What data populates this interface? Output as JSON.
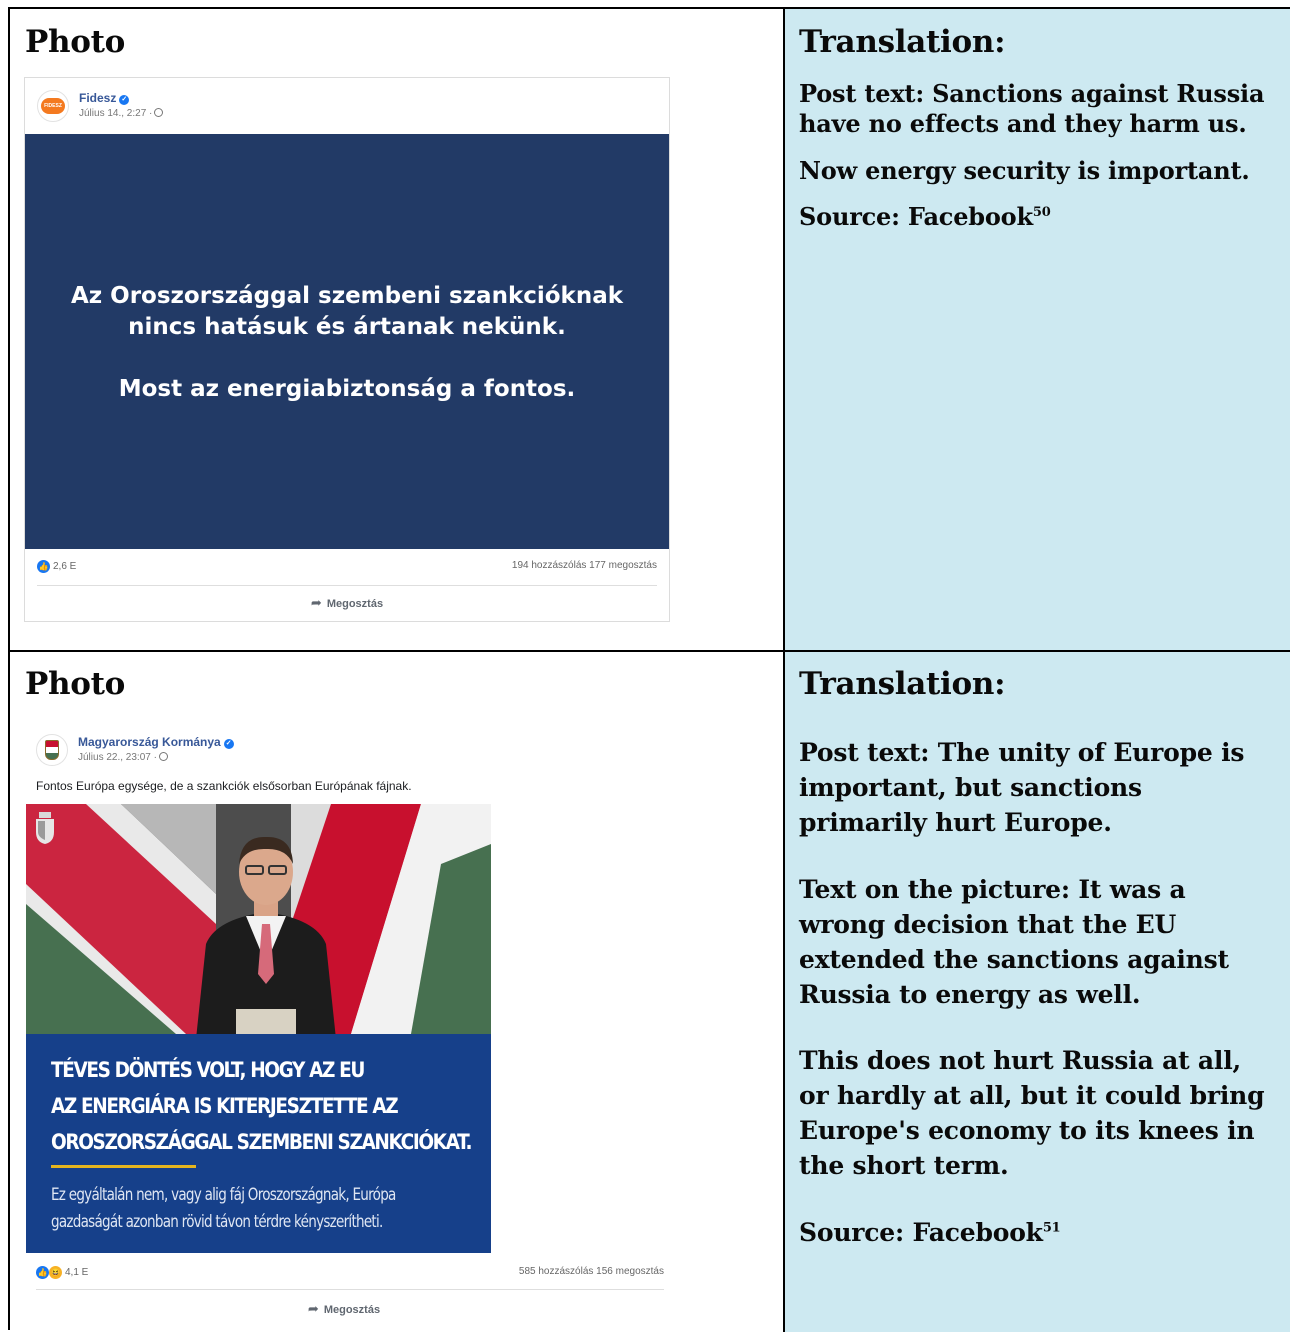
{
  "rows": [
    {
      "photo_heading": "Photo",
      "translation_heading": "Translation:",
      "post": {
        "page_name": "Fidesz",
        "avatar_text": "FIDESZ",
        "date": "Július 14., 2:27 ·",
        "image_text_line1": "Az Oroszországgal szembeni szankcióknak",
        "image_text_line2": "nincs hatásuk és ártanak nekünk.",
        "image_text_line3": "Most az energiabiztonság a fontos.",
        "reactions_count": "2,6 E",
        "counts": "194 hozzászólás  177 megosztás",
        "share_label": "Megosztás",
        "box_color": "#223a66"
      },
      "translation": {
        "p1": "Post text: Sanctions against Russia have no effects and they harm us.",
        "p2": "Now energy security is important.",
        "source": "Source: Facebook",
        "footnote": "50"
      }
    },
    {
      "photo_heading": "Photo",
      "translation_heading": "Translation:",
      "post": {
        "page_name": "Magyarország Kormánya",
        "date": "Július 22., 23:07 ·",
        "caption": "Fontos Európa egysége, de a szankciók elsősorban Európának fájnak.",
        "banner_line1": "TÉVES DÖNTÉS VOLT, HOGY AZ EU",
        "banner_line2": "AZ ENERGIÁRA IS KITERJESZTETTE AZ",
        "banner_line3": "OROSZORSZÁGGAL SZEMBENI SZANKCIÓKAT.",
        "banner_sub1": "Ez egyáltalán nem, vagy alig fáj Oroszországnak, Európa",
        "banner_sub2": "gazdaságát azonban rövid távon térdre kényszerítheti.",
        "reactions_count": "4,1 E",
        "counts": "585 hozzászólás  156 megosztás",
        "share_label": "Megosztás",
        "banner_color": "#16408a"
      },
      "translation": {
        "p1": "Post text: The unity of Europe is important, but sanctions primarily hurt Europe.",
        "p2": "Text on the picture: It was a wrong decision that the EU extended the sanctions against Russia to energy as well.",
        "p3": "This does not hurt Russia at all, or hardly at all, but it could bring Europe's economy to its knees in the short term.",
        "source": "Source: Facebook",
        "footnote": "51"
      }
    }
  ],
  "colors": {
    "translation_bg": "#cde9f1",
    "facebook_blue": "#1877f2",
    "flag_red": "#c8102e",
    "flag_green": "#477050"
  }
}
